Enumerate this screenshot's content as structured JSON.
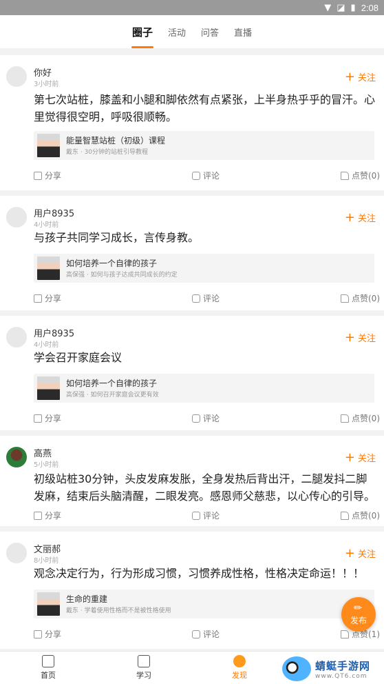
{
  "status_bar": {
    "time": "2:08",
    "icons": [
      "wifi-icon",
      "signal-icon",
      "battery-icon"
    ]
  },
  "top_tabs": [
    {
      "label": "圈子",
      "active": true
    },
    {
      "label": "活动",
      "active": false
    },
    {
      "label": "问答",
      "active": false
    },
    {
      "label": "直播",
      "active": false
    }
  ],
  "posts": [
    {
      "user": "你好",
      "time": "3小时前",
      "follow": "关注",
      "text": "第七次站桩，膝盖和小腿和脚依然有点紧张，上半身热乎乎的冒汗。心里觉得很空明，呼吸很顺畅。",
      "card": {
        "title": "能量智慧站桩（初级）课程",
        "subtitle": "戴东 · 30分钟的站桩引导教程"
      },
      "share": "分享",
      "comment": "评论",
      "like": "点赞(0)"
    },
    {
      "user": "用户8935",
      "time": "4小时前",
      "follow": "关注",
      "text": "与孩子共同学习成长，言传身教。",
      "card": {
        "title": "如何培养一个自律的孩子",
        "subtitle": "高保强 · 如何与孩子达成共同成长的约定"
      },
      "share": "分享",
      "comment": "评论",
      "like": "点赞(0)"
    },
    {
      "user": "用户8935",
      "time": "4小时前",
      "follow": "关注",
      "text": "学会召开家庭会议",
      "card": {
        "title": "如何培养一个自律的孩子",
        "subtitle": "高保强 · 如何召开家庭会议更有效"
      },
      "share": "分享",
      "comment": "评论",
      "like": "点赞(0)"
    },
    {
      "user": "高燕",
      "time": "5小时前",
      "follow": "关注",
      "text": "初级站桩30分钟，头皮发麻发胀，全身发热后背出汗，二腿发抖二脚发麻，结束后头脑清醒，二眼发亮。感恩师父慈悲，以心传心的引导。",
      "card": null,
      "share": "分享",
      "comment": "评论",
      "like": "点赞(0)"
    },
    {
      "user": "文丽郝",
      "time": "8小时前",
      "follow": "关注",
      "text": "观念决定行为，行为形成习惯，习惯养成性格，性格决定命运！！！",
      "card": {
        "title": "生命的重建",
        "subtitle": "戴东 · 学着使用性格而不是被性格使用"
      },
      "share": "分享",
      "comment": "评论",
      "like": "点赞(1)"
    }
  ],
  "fab": {
    "label": "发布"
  },
  "bottom_nav": [
    {
      "label": "首页"
    },
    {
      "label": "学习"
    },
    {
      "label": "发现",
      "active": true
    }
  ],
  "watermark": {
    "name": "蜻蜓手游网",
    "url": "www.QT6.com"
  }
}
